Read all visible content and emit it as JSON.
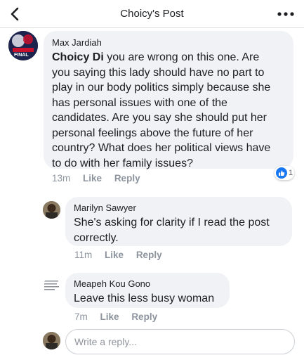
{
  "header": {
    "title": "Choicy's Post",
    "back_icon": "chevron-left-icon",
    "more_icon": "more-dots-icon"
  },
  "comments": [
    {
      "author": "Max Jardiah",
      "mention": "Choicy Di",
      "lines": [
        " you are wrong on this one. Are",
        "you saying this lady should have no part to",
        "play in our body politics simply because she",
        "has personal issues with one of the",
        "candidates. Are you say she should put her",
        "personal feelings above the future of her",
        "country? What does her political views have",
        "to do with her family issues?"
      ],
      "time": "13m",
      "like": "Like",
      "reply": "Reply",
      "avatar_text": "FINAL",
      "reactions": {
        "count": "1",
        "icon": "like-thumb-icon"
      }
    },
    {
      "author": "Marilyn Sawyer",
      "lines": [
        "She's asking for clarity if I read the post",
        "correctly."
      ],
      "time": "11m",
      "like": "Like",
      "reply": "Reply"
    },
    {
      "author": "Meapeh Kou Gono",
      "lines": [
        "Leave this less busy woman"
      ],
      "time": "7m",
      "like": "Like",
      "reply": "Reply"
    }
  ],
  "composer": {
    "placeholder": "Write a reply..."
  },
  "colors": {
    "bubble": "#f0f2f5",
    "like_blue": "#1877f2",
    "meta_gray": "#8d949e"
  }
}
